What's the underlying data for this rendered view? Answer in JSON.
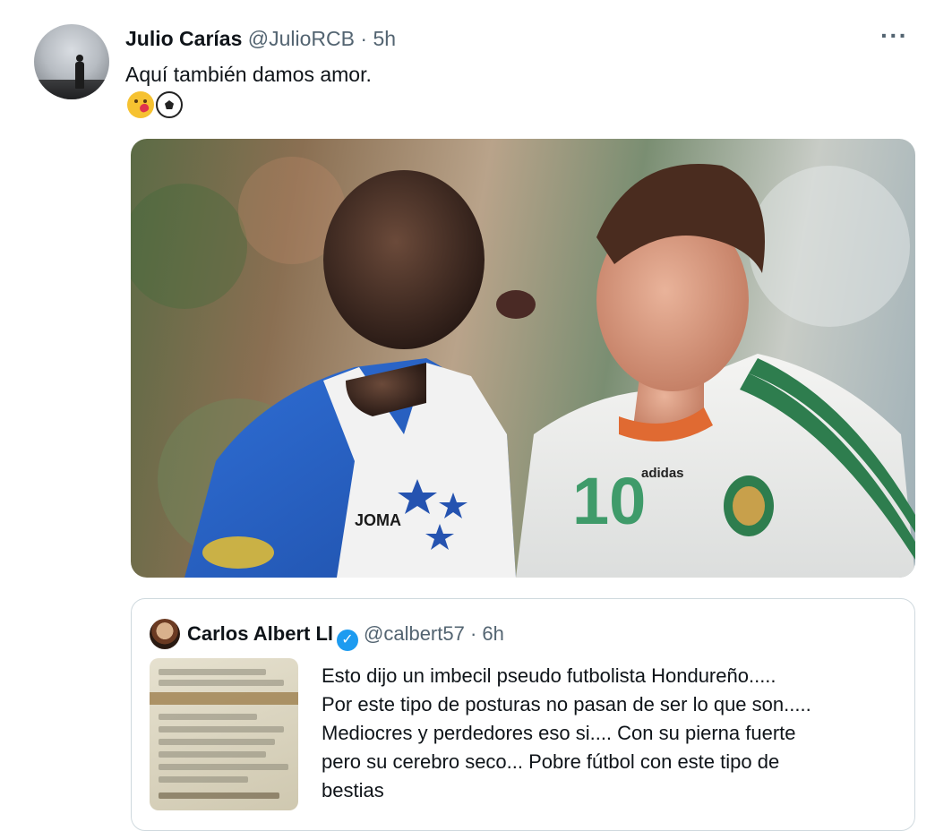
{
  "tweet": {
    "author_name": "Julio Carías",
    "author_handle": "@JulioRCB",
    "separator": "·",
    "time": "5h",
    "more_label": "···",
    "text": "Aquí también damos amor.",
    "emojis": [
      "kissing-face-with-heart-emoji",
      "soccer-ball-emoji"
    ],
    "photo": {
      "jersey_number": "10",
      "left_brand": "JOMA",
      "right_brand": "adidas"
    }
  },
  "quote": {
    "author_name": "Carlos Albert Ll",
    "verified": "✓",
    "author_handle": "@calbert57",
    "separator": "·",
    "time": "6h",
    "lines": [
      "Esto dijo un imbecil pseudo futbolista Hondureño.....",
      "Por este tipo de posturas no pasan de ser lo que son.....",
      "Mediocres y perdedores eso si.... Con su pierna fuerte",
      "pero su cerebro seco... Pobre fútbol con este tipo de",
      "bestias"
    ]
  },
  "colors": {
    "text": "#0f1419",
    "secondary": "#536471",
    "verified": "#1d9bf0",
    "border": "#cfd9de"
  }
}
